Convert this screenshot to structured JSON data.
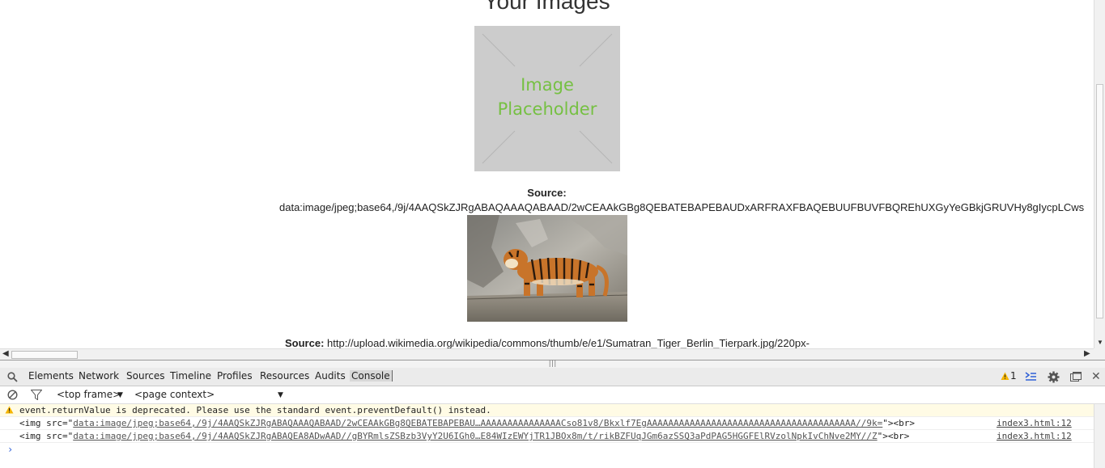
{
  "page": {
    "heading": "Your Images",
    "placeholder_text_line1": "Image",
    "placeholder_text_line2": "Placeholder",
    "source1_label": "Source:",
    "source1_value": "data:image/jpeg;base64,/9j/4AAQSkZJRgABAQAAAQABAAD/2wCEAAkGBg8QEBATEBAPEBAUDxARFRAXFBAQEBUUFBUVFBQREhUXGyYeGBkjGRUVHy8gIycpLCws",
    "source2_label": "Source:",
    "source2_value": "http://upload.wikimedia.org/wikipedia/commons/thumb/e/e1/Sumatran_Tiger_Berlin_Tierpark.jpg/220px-"
  },
  "devtools": {
    "tabs": [
      "Elements",
      "Network",
      "Sources",
      "Timeline",
      "Profiles",
      "Resources",
      "Audits",
      "Console"
    ],
    "active_tab": "Console",
    "warning_count": "1",
    "frame_select": "<top frame>",
    "context_select": "<page context>",
    "console": [
      {
        "type": "warning",
        "text": "event.returnValue is deprecated. Please use the standard event.preventDefault() instead.",
        "source": ""
      },
      {
        "type": "log",
        "prefix": "<img src=\"",
        "link": "data:image/jpeg;base64,/9j/4AAQSkZJRgABAQAAAQABAAD/2wCEAAkGBg8QEBATEBAPEBAU…AAAAAAAAAAAAAAACso81v8/Bkxlf7EgAAAAAAAAAAAAAAAAAAAAAAAAAAAAAAAAAAAAAAA//9k=",
        "suffix": "\"><br>",
        "source": "index3.html:12"
      },
      {
        "type": "log",
        "prefix": "<img src=\"",
        "link": "data:image/jpeg;base64,/9j/4AAQSkZJRgABAQEA8ADwAAD//gBYRmlsZSBzb3VyY2U6IGh0…E84WIzEWYjTR1JBOx8m/t/rikBZFUqJGm6azSSQ3aPdPAG5HGGFElRVzolNpkIvChNve2MY//Z",
        "suffix": "\"><br>",
        "source": "index3.html:12"
      }
    ]
  },
  "colors": {
    "placeholder_bg": "#cccccc",
    "placeholder_text": "#76c043",
    "warning": "#f4b400",
    "prompt": "#2d5ed6"
  }
}
